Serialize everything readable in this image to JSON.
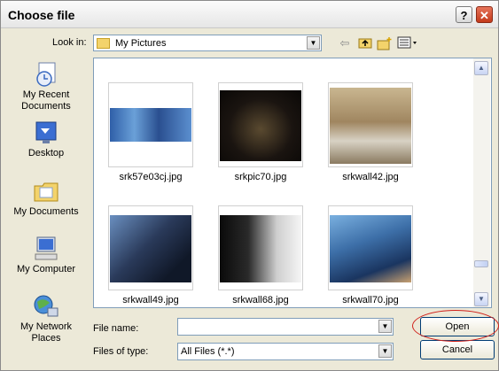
{
  "window": {
    "title": "Choose file",
    "help_label": "?",
    "close_label": "✕"
  },
  "toolbar": {
    "look_in_label": "Look in:",
    "look_in_value": "My Pictures",
    "icons": [
      "back-arrow-icon",
      "up-folder-icon",
      "new-folder-icon",
      "views-menu-icon"
    ]
  },
  "places": [
    {
      "label_lines": [
        "My Recent",
        "Documents"
      ],
      "icon": "recent-documents-icon"
    },
    {
      "label_lines": [
        "Desktop"
      ],
      "icon": "desktop-icon"
    },
    {
      "label_lines": [
        "My Documents"
      ],
      "icon": "my-documents-icon"
    },
    {
      "label_lines": [
        "My Computer"
      ],
      "icon": "my-computer-icon"
    },
    {
      "label_lines": [
        "My Network",
        "Places"
      ],
      "icon": "network-places-icon"
    }
  ],
  "files": [
    {
      "name": "srk57e03cj.jpg"
    },
    {
      "name": "srkpic70.jpg"
    },
    {
      "name": "srkwall42.jpg"
    },
    {
      "name": "srkwall49.jpg"
    },
    {
      "name": "srkwall68.jpg"
    },
    {
      "name": "srkwall70.jpg"
    }
  ],
  "thumb_colors": [
    "#3f6fb0",
    "#1a1410",
    "#b49870",
    "#2a3a5a",
    "#151515",
    "#3d6fa8"
  ],
  "form": {
    "file_name_label": "File name:",
    "file_name_value": "",
    "file_type_label": "Files of type:",
    "file_type_value": "All Files (*.*)"
  },
  "buttons": {
    "open": "Open",
    "cancel": "Cancel"
  },
  "scrollbar": {
    "up": "▲",
    "down": "▼"
  },
  "annotation_color": "#d0201a"
}
